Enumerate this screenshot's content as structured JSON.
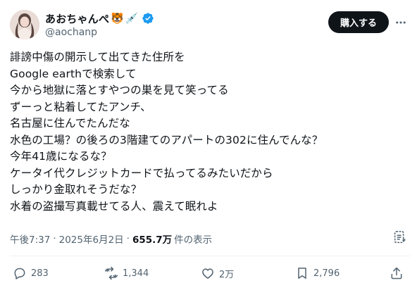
{
  "author": {
    "display_name": "あおちゃんぺ",
    "emoji_tiger": "🐯",
    "emoji_syringe": "💉",
    "handle": "@aochanp",
    "verified": true,
    "avatar_icon": "avatar-photo"
  },
  "header": {
    "buy_label": "購入する",
    "more_icon": "more-icon"
  },
  "tweet": {
    "lines": [
      "誹謗中傷の開示して出てきた住所を",
      "Google earthで検索して",
      "今から地獄に落とすやつの巣を見て笑ってる",
      "ずーっと粘着してたアンチ、",
      "名古屋に住んでたんだな",
      "水色の工場？の後ろの3階建てのアパートの302に住んでんな？",
      "今年41歳になるな？",
      "ケータイ代クレジットカードで払ってるみたいだから",
      "しっかり金取れそうだな？",
      "水着の盗撮写真載せてる人、震えて眠れよ"
    ]
  },
  "meta": {
    "time": "午後7:37",
    "date": "2025年6月2日",
    "views_count": "655.7万",
    "views_label": "件の表示",
    "separator": "·"
  },
  "actions": {
    "replies": "283",
    "reposts": "1,344",
    "likes": "2万",
    "bookmarks": "2,796"
  },
  "colors": {
    "text": "#0f1419",
    "secondary": "#536471",
    "verified": "#1d9bf0",
    "button_bg": "#0f1419"
  }
}
